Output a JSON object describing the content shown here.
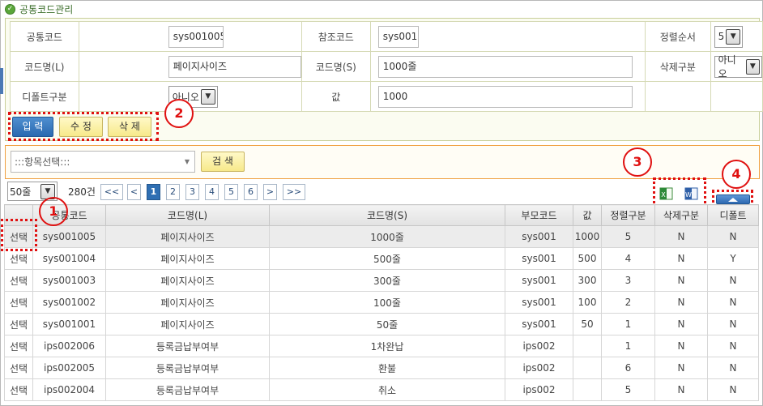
{
  "page": {
    "title": "공통코드관리"
  },
  "form": {
    "common_code_label": "공통코드",
    "common_code_value": "sys001005",
    "ref_code_label": "참조코드",
    "ref_code_value": "sys001",
    "sort_order_label": "정렬순서",
    "sort_order_value": "5",
    "code_name_l_label": "코드명(L)",
    "code_name_l_value": "페이지사이즈",
    "code_name_s_label": "코드명(S)",
    "code_name_s_value": "1000줄",
    "delete_flag_label": "삭제구분",
    "delete_flag_value": "아니오",
    "default_flag_label": "디폴트구분",
    "default_flag_value": "아니오",
    "value_label": "값",
    "value_value": "1000"
  },
  "actions": {
    "insert_label": "입 력",
    "update_label": "수 정",
    "delete_label": "삭 제"
  },
  "search": {
    "item_select_value": ":::항목선택:::",
    "search_label": "검 색"
  },
  "pager": {
    "page_size_value": "50줄",
    "total_count": "280건",
    "first_label": "<<",
    "prev_label": "<",
    "pages": [
      "1",
      "2",
      "3",
      "4",
      "5",
      "6"
    ],
    "current_page": "1",
    "next_label": ">",
    "last_label": ">>"
  },
  "icons": {
    "excel": "excel-export-icon",
    "word": "word-export-icon",
    "scroll_up": "collapse-up-icon"
  },
  "annotations": [
    "1",
    "2",
    "3",
    "4"
  ],
  "colors": {
    "accent_blue": "#2f6fb3",
    "annotation_red": "#e01010",
    "button_yellow": "#f7e98a"
  },
  "grid": {
    "columns": [
      "",
      "공통코드",
      "코드명(L)",
      "코드명(S)",
      "부모코드",
      "값",
      "정렬구분",
      "삭제구분",
      "디폴트"
    ],
    "rows": [
      [
        "선택",
        "sys001005",
        "페이지사이즈",
        "1000줄",
        "sys001",
        "1000",
        "5",
        "N",
        "N"
      ],
      [
        "선택",
        "sys001004",
        "페이지사이즈",
        "500줄",
        "sys001",
        "500",
        "4",
        "N",
        "Y"
      ],
      [
        "선택",
        "sys001003",
        "페이지사이즈",
        "300줄",
        "sys001",
        "300",
        "3",
        "N",
        "N"
      ],
      [
        "선택",
        "sys001002",
        "페이지사이즈",
        "100줄",
        "sys001",
        "100",
        "2",
        "N",
        "N"
      ],
      [
        "선택",
        "sys001001",
        "페이지사이즈",
        "50줄",
        "sys001",
        "50",
        "1",
        "N",
        "N"
      ],
      [
        "선택",
        "ips002006",
        "등록금납부여부",
        "1차완납",
        "ips002",
        "",
        "1",
        "N",
        "N"
      ],
      [
        "선택",
        "ips002005",
        "등록금납부여부",
        "환불",
        "ips002",
        "",
        "6",
        "N",
        "N"
      ],
      [
        "선택",
        "ips002004",
        "등록금납부여부",
        "취소",
        "ips002",
        "",
        "5",
        "N",
        "N"
      ]
    ]
  }
}
